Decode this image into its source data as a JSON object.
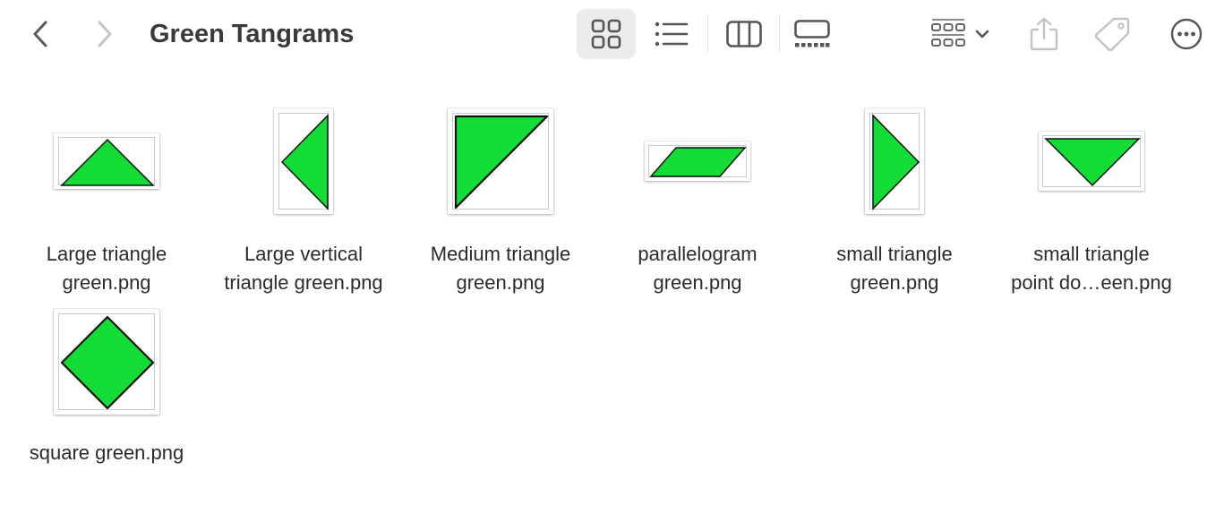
{
  "window": {
    "title": "Green Tangrams"
  },
  "toolbar": {
    "back_icon": "chevron-left-icon",
    "forward_icon": "chevron-right-icon",
    "view_modes": [
      "icons",
      "list",
      "columns",
      "gallery"
    ],
    "selected_view": "icons",
    "group_icon": "group-by-icon",
    "share_icon": "share-icon",
    "tag_icon": "tag-icon",
    "more_icon": "ellipsis-circle-icon"
  },
  "colors": {
    "shape_fill": "#12dc35",
    "shape_stroke": "#111111",
    "selected_view_bg": "#ececec",
    "icon_color": "#595959",
    "disabled_icon_color": "#c4c4c4"
  },
  "files": [
    {
      "line1": "Large triangle",
      "line2": "green.png",
      "shape": "triangle-up"
    },
    {
      "line1": "Large vertical",
      "line2": "triangle green.png",
      "shape": "triangle-left"
    },
    {
      "line1": "Medium triangle",
      "line2": "green.png",
      "shape": "triangle-right-angle"
    },
    {
      "line1": "parallelogram",
      "line2": "green.png",
      "shape": "parallelogram"
    },
    {
      "line1": "small triangle",
      "line2": "green.png",
      "shape": "triangle-right"
    },
    {
      "line1": "small triangle",
      "line2": "point do…een.png",
      "shape": "triangle-down"
    },
    {
      "line1": "square green.png",
      "line2": "",
      "shape": "square-diamond"
    }
  ]
}
